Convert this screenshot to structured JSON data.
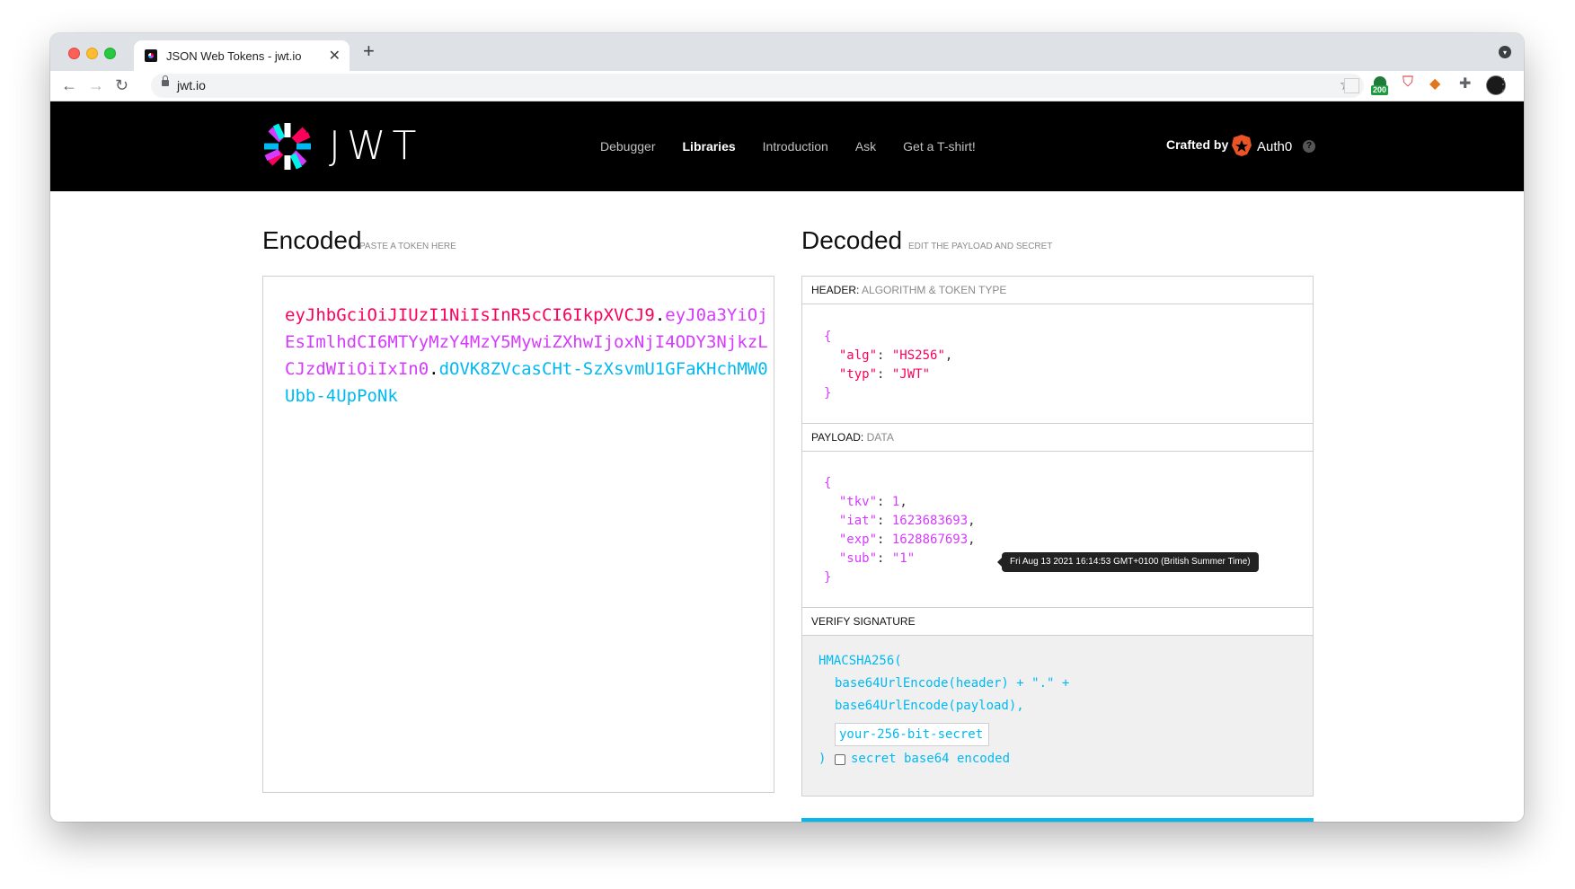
{
  "browser": {
    "tab_title": "JSON Web Tokens - jwt.io",
    "url": "jwt.io",
    "extension_badge": "200"
  },
  "site": {
    "logo_text": "JWT",
    "nav": [
      "Debugger",
      "Libraries",
      "Introduction",
      "Ask",
      "Get a T-shirt!"
    ],
    "active_nav": "Libraries",
    "crafted_by": "Crafted by",
    "auth0": "Auth0",
    "help": "?"
  },
  "encoded": {
    "title": "Encoded",
    "subtitle": "PASTE A TOKEN HERE",
    "token_header": "eyJhbGciOiJIUzI1NiIsInR5cCI6IkpXVCJ9",
    "token_payload": "eyJ0a3YiOjEsImlhdCI6MTYyMzY4MzY5MywiZXhwIjoxNjI4ODY3NjkzLCJzdWIiOiIxIn0",
    "token_signature": "dOVK8ZVcasCHt-SzXsvmU1GFaKHchMW0Ubb-4UpPoNk",
    "dot": "."
  },
  "decoded": {
    "title": "Decoded",
    "subtitle": "EDIT THE PAYLOAD AND SECRET",
    "header_label": "HEADER:",
    "header_label_lite": "ALGORITHM & TOKEN TYPE",
    "header_lines": [
      {
        "key": "\"alg\"",
        "value": "\"HS256\"",
        "sep": ": ",
        "end": ","
      },
      {
        "key": "\"typ\"",
        "value": "\"JWT\"",
        "sep": ": ",
        "end": ""
      }
    ],
    "payload_label": "PAYLOAD:",
    "payload_label_lite": "DATA",
    "payload_lines": [
      {
        "key": "\"tkv\"",
        "value": "1",
        "sep": ": ",
        "end": ","
      },
      {
        "key": "\"iat\"",
        "value": "1623683693",
        "sep": ": ",
        "end": ","
      },
      {
        "key": "\"exp\"",
        "value": "1628867693",
        "sep": ": ",
        "end": ","
      },
      {
        "key": "\"sub\"",
        "value": "\"1\"",
        "sep": ": ",
        "end": ""
      }
    ],
    "open_brace": "{",
    "close_brace": "}",
    "tooltip": "Fri Aug 13 2021 16:14:53 GMT+0100 (British Summer Time)",
    "verify_label": "VERIFY SIGNATURE",
    "verify_fn": "HMACSHA256(",
    "verify_line1": "base64UrlEncode(header) + \".\" +",
    "verify_line2": "base64UrlEncode(payload),",
    "secret_placeholder": "your-256-bit-secret",
    "verify_close": ")",
    "base64_label": "secret base64 encoded"
  }
}
